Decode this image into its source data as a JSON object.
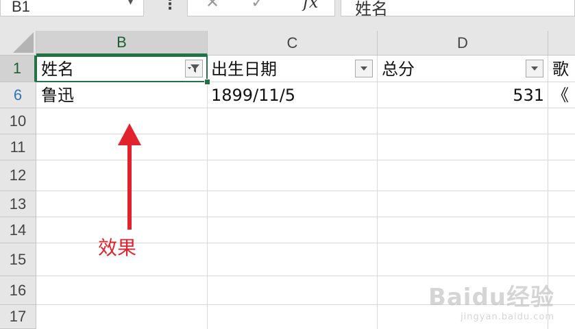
{
  "name_box": {
    "value": "B1"
  },
  "formula_bar": {
    "value": "姓名",
    "fx_label": "fx"
  },
  "columns": [
    {
      "letter": "B",
      "active": true
    },
    {
      "letter": "C",
      "active": false
    },
    {
      "letter": "D",
      "active": false
    }
  ],
  "rows": [
    "1",
    "6",
    "10",
    "11",
    "12",
    "13",
    "14",
    "15",
    "16",
    "17"
  ],
  "headers": {
    "b": "姓名",
    "c": "出生日期",
    "d": "总分",
    "e": "歌"
  },
  "data_row": {
    "b": "鲁迅",
    "c": "1899/11/5",
    "d": "531",
    "e": "《"
  },
  "annotation": {
    "label": "效果",
    "color": "#e2222d"
  },
  "watermark": {
    "brand": "Baidu经验",
    "url": "jingyan.baidu.com"
  },
  "colors": {
    "accent": "#217346",
    "filtered_row": "#2e75b6"
  }
}
